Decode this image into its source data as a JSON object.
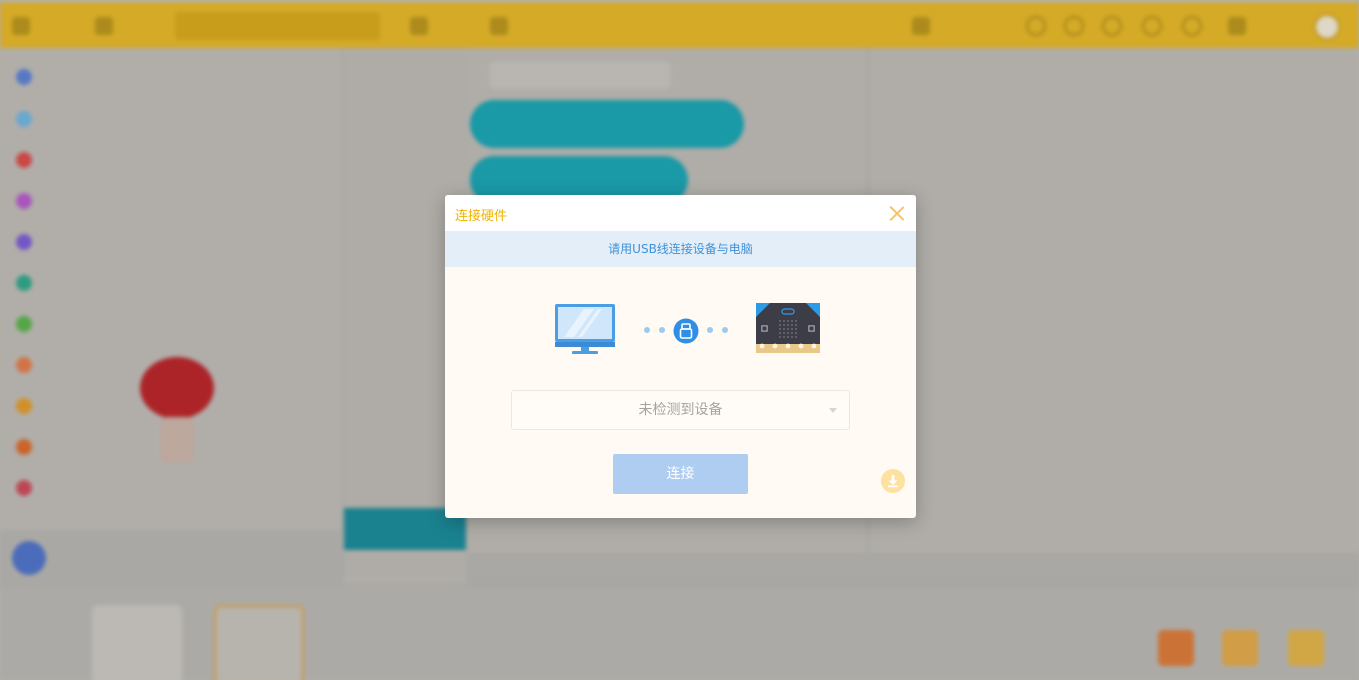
{
  "dialog": {
    "title": "连接硬件",
    "instruction": "请用USB线连接设备与电脑",
    "device_select": {
      "value": "未检测到设备"
    },
    "connect_label": "连接"
  },
  "icons": {
    "close": "close-icon",
    "computer": "computer-monitor-icon",
    "usb": "usb-plug-icon",
    "board": "microbit-board-icon",
    "download": "download-icon",
    "caret": "chevron-down-icon"
  },
  "colors": {
    "title": "#f0b400",
    "banner_bg": "#e3eef9",
    "banner_text": "#3f92d8",
    "connect_button": "#aecdf0",
    "topbar": "#e3b628",
    "block": "#19a3b2",
    "category_dots": [
      "#5b7fd4",
      "#6fb3e0",
      "#d84a4a",
      "#b55ac9",
      "#7a5bd4",
      "#2fa68a",
      "#58b14a",
      "#e07a4a",
      "#e09a2a",
      "#d86a2a",
      "#c94a5a"
    ]
  }
}
